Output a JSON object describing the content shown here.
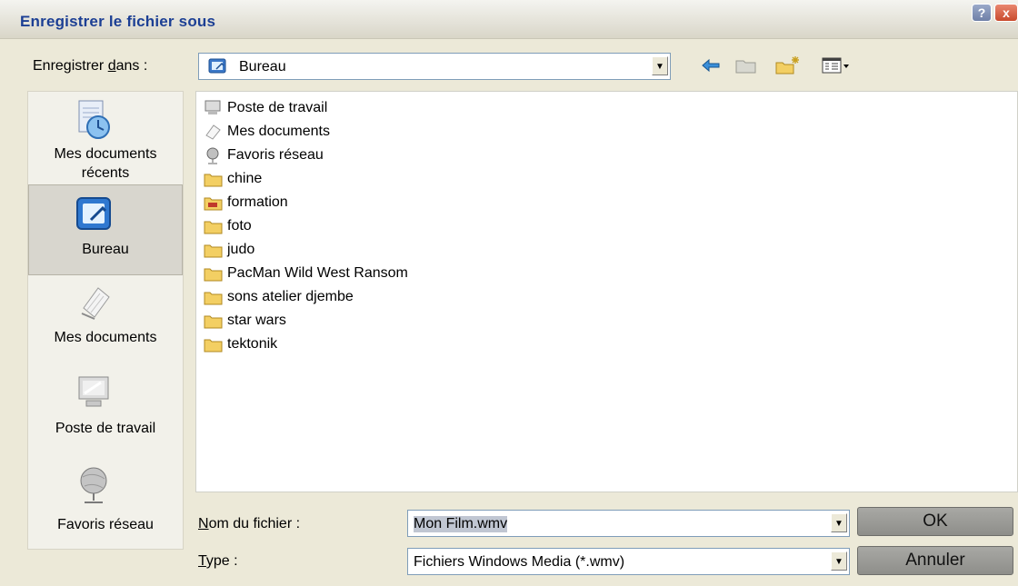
{
  "window": {
    "title": "Enregistrer le fichier sous"
  },
  "titlebar": {
    "help_label": "?",
    "close_label": "x"
  },
  "save_in": {
    "label_before": "Enregistrer ",
    "label_underlined": "d",
    "label_after": "ans :",
    "value": "Bureau"
  },
  "places": [
    {
      "label_line1": "Mes documents",
      "label_line2": "récents",
      "icon": "recent-docs-icon"
    },
    {
      "label_line1": "Bureau",
      "label_line2": "",
      "icon": "desktop-icon"
    },
    {
      "label_line1": "Mes documents",
      "label_line2": "",
      "icon": "my-documents-icon"
    },
    {
      "label_line1": "Poste de travail",
      "label_line2": "",
      "icon": "my-computer-icon"
    },
    {
      "label_line1": "Favoris réseau",
      "label_line2": "",
      "icon": "network-places-icon"
    }
  ],
  "files": [
    {
      "name": "Poste de travail",
      "icon": "my-computer-icon"
    },
    {
      "name": "Mes documents",
      "icon": "my-documents-icon"
    },
    {
      "name": "Favoris réseau",
      "icon": "network-places-icon"
    },
    {
      "name": "chine",
      "icon": "folder-icon"
    },
    {
      "name": "formation",
      "icon": "folder-open-icon"
    },
    {
      "name": "foto",
      "icon": "folder-icon"
    },
    {
      "name": "judo",
      "icon": "folder-icon"
    },
    {
      "name": "PacMan Wild West Ransom",
      "icon": "folder-icon"
    },
    {
      "name": "sons atelier djembe",
      "icon": "folder-icon"
    },
    {
      "name": "star wars",
      "icon": "folder-icon"
    },
    {
      "name": "tektonik",
      "icon": "folder-icon"
    }
  ],
  "filename": {
    "label_underlined": "N",
    "label_rest": "om du fichier :",
    "value": "Mon Film.wmv"
  },
  "filetype": {
    "label_underlined": "T",
    "label_rest": "ype :",
    "value": "Fichiers Windows Media (*.wmv)"
  },
  "buttons": {
    "ok": "OK",
    "cancel": "Annuler"
  },
  "colors": {
    "title_text": "#1c3f94",
    "list_bg": "#ffffff",
    "dialog_bg": "#ece9d8",
    "folder": "#f0c040"
  }
}
